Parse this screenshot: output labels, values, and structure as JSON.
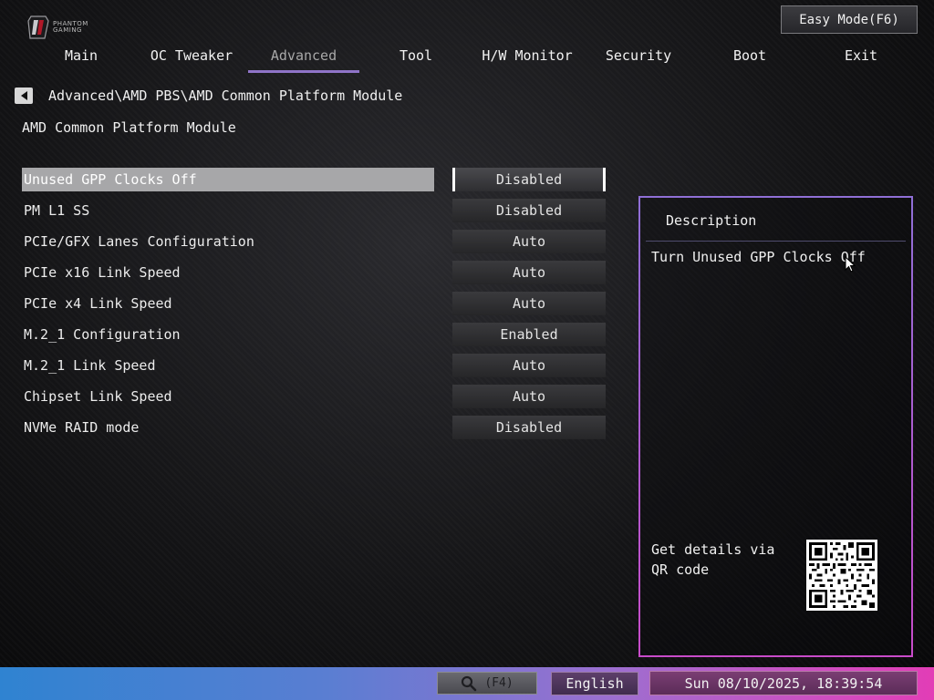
{
  "brand": {
    "logo_text_line1": "PHANTOM",
    "logo_text_line2": "GAMING"
  },
  "easy_mode_label": "Easy Mode(F6)",
  "tabs": [
    {
      "label": "Main",
      "active": false
    },
    {
      "label": "OC Tweaker",
      "active": false
    },
    {
      "label": "Advanced",
      "active": true
    },
    {
      "label": "Tool",
      "active": false
    },
    {
      "label": "H/W Monitor",
      "active": false
    },
    {
      "label": "Security",
      "active": false
    },
    {
      "label": "Boot",
      "active": false
    },
    {
      "label": "Exit",
      "active": false
    }
  ],
  "breadcrumb": "Advanced\\AMD PBS\\AMD Common Platform Module",
  "page_title": "AMD Common Platform Module",
  "settings": [
    {
      "label": "Unused GPP Clocks Off",
      "value": "Disabled",
      "selected": true
    },
    {
      "label": "PM L1 SS",
      "value": "Disabled",
      "selected": false
    },
    {
      "label": "PCIe/GFX Lanes Configuration",
      "value": "Auto",
      "selected": false
    },
    {
      "label": "PCIe x16 Link Speed",
      "value": "Auto",
      "selected": false
    },
    {
      "label": "PCIe x4 Link Speed",
      "value": "Auto",
      "selected": false
    },
    {
      "label": "M.2_1 Configuration",
      "value": "Enabled",
      "selected": false
    },
    {
      "label": "M.2_1 Link Speed",
      "value": "Auto",
      "selected": false
    },
    {
      "label": "Chipset Link Speed",
      "value": "Auto",
      "selected": false
    },
    {
      "label": "NVMe RAID mode",
      "value": "Disabled",
      "selected": false
    }
  ],
  "description": {
    "title": "Description",
    "text": "Turn Unused GPP Clocks Off",
    "qr_text": "Get details via QR code"
  },
  "footer": {
    "search_label": "(F4)",
    "language": "English",
    "datetime": "Sun 08/10/2025, 18:39:54"
  },
  "colors": {
    "accent_tab_underline": "#8f74c8",
    "panel_border_top": "#8f6fd6",
    "panel_border_bottom": "#c84bc9",
    "bottom_bar_left": "#2f83d1",
    "bottom_bar_right": "#e23db6"
  },
  "icons": {
    "back": "back-arrow-icon",
    "search": "search-icon",
    "qr": "qr-code-icon",
    "cursor": "mouse-cursor-icon",
    "logo": "phantom-gaming-logo"
  }
}
